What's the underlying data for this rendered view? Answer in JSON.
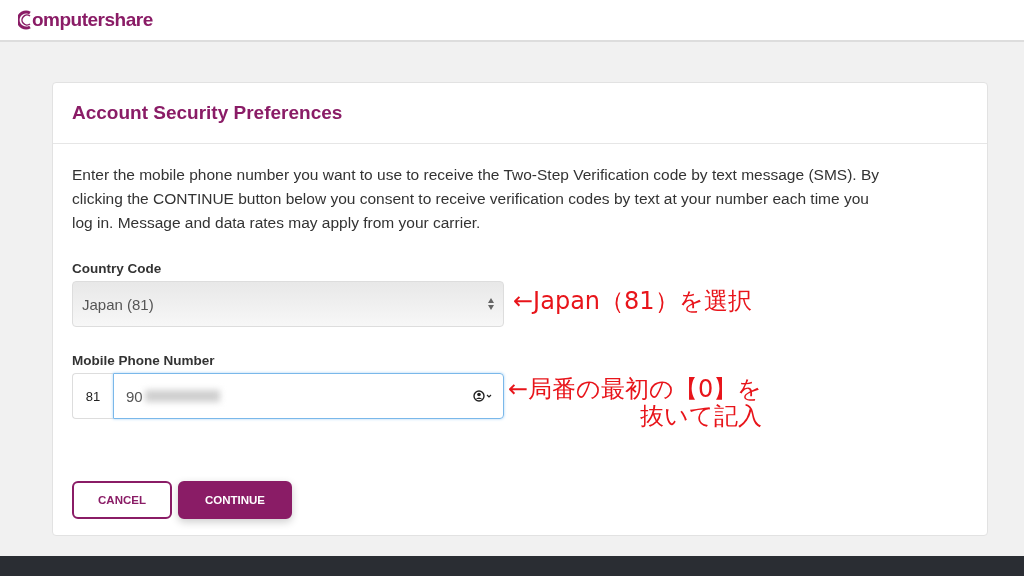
{
  "header": {
    "logo": "omputershare"
  },
  "card": {
    "title": "Account Security Preferences",
    "intro": "Enter the mobile phone number you want to use to receive the Two-Step Verification code by text message (SMS). By clicking the CONTINUE button below you consent to receive verification codes by text at your number each time you log in. Message and data rates may apply from your carrier.",
    "country_code": {
      "label": "Country Code",
      "value": "Japan (81)"
    },
    "mobile_phone": {
      "label": "Mobile Phone Number",
      "prefix": "81",
      "value": "90",
      "redacted": true
    },
    "buttons": [
      {
        "label": "CANCEL",
        "kind": "secondary"
      },
      {
        "label": "CONTINUE",
        "kind": "primary"
      }
    ]
  },
  "annotations": [
    {
      "lines": [
        "←Japan（81）を選択"
      ]
    },
    {
      "lines": [
        "←局番の最初の【0】を",
        "抜いて記入"
      ]
    }
  ]
}
